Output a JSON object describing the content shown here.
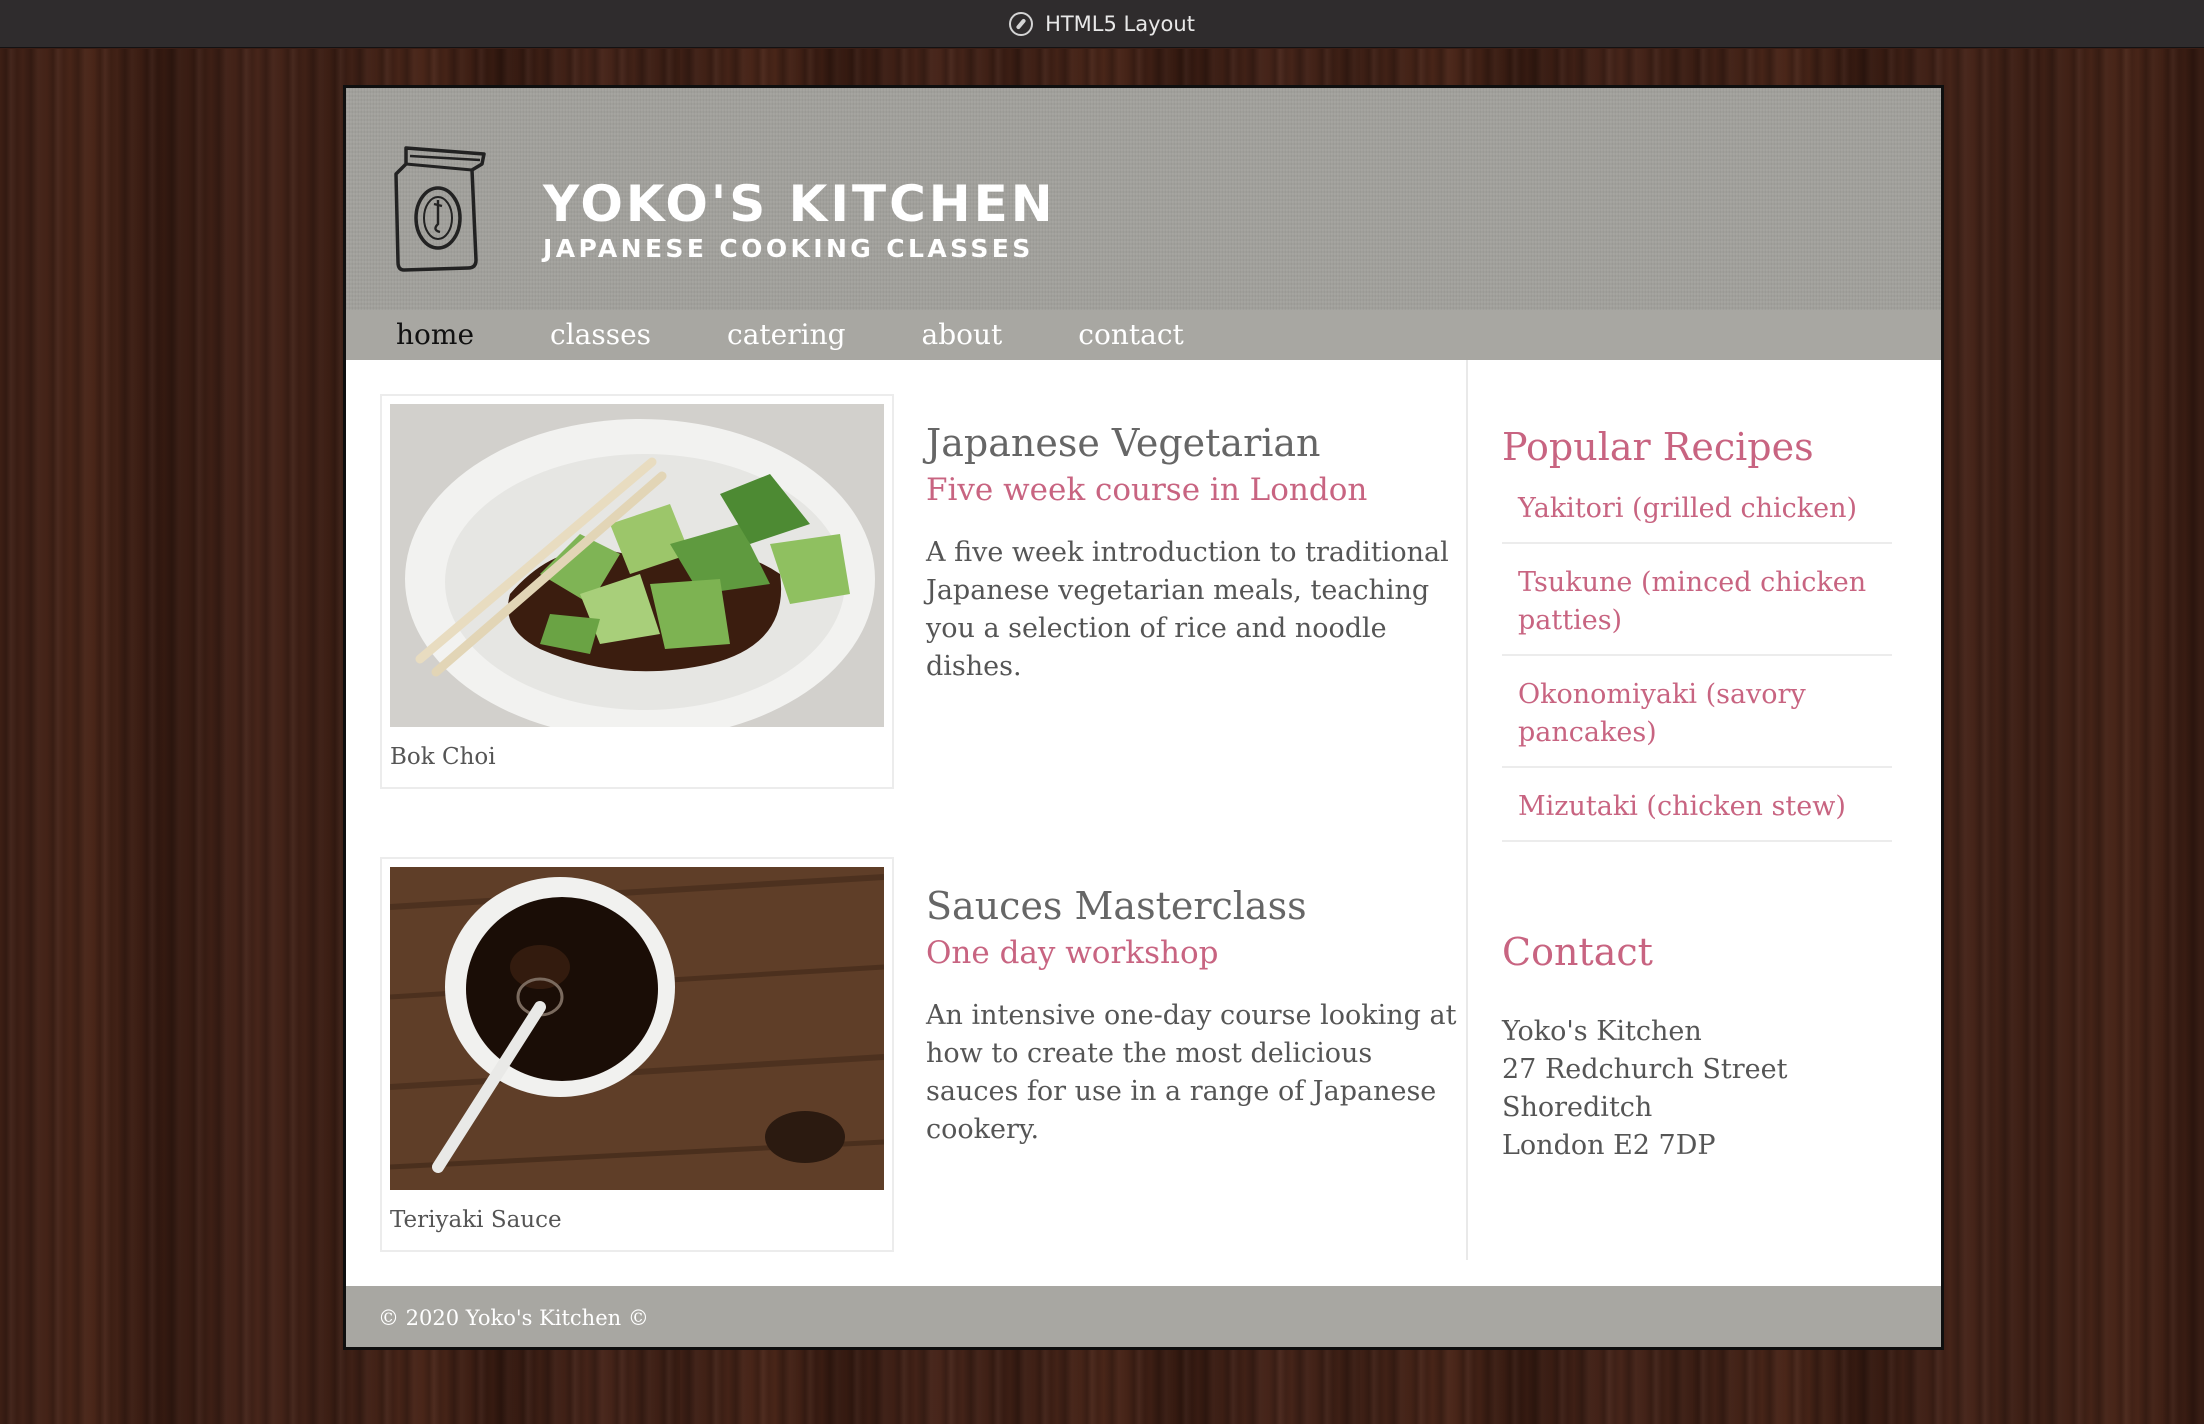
{
  "window": {
    "title": "HTML5 Layout",
    "title_icon": "compass-icon"
  },
  "header": {
    "brand_name": "YOKO'S KITCHEN",
    "brand_tagline": "JAPANESE COOKING CLASSES",
    "logo_icon": "bag-logo-icon"
  },
  "nav": {
    "items": [
      {
        "label": "home",
        "active": true
      },
      {
        "label": "classes",
        "active": false
      },
      {
        "label": "catering",
        "active": false
      },
      {
        "label": "about",
        "active": false
      },
      {
        "label": "contact",
        "active": false
      }
    ]
  },
  "courses": [
    {
      "image_caption": "Bok Choi",
      "title": "Japanese Vegetarian",
      "subtitle": "Five week course in London",
      "description": "A five week introduction to traditional Japanese vegetarian meals, teaching you a selection of rice and noodle dishes."
    },
    {
      "image_caption": "Teriyaki Sauce",
      "title": "Sauces Masterclass",
      "subtitle": "One day workshop",
      "description": "An intensive one-day course looking at how to create the most delicious sauces for use in a range of Japanese cookery."
    }
  ],
  "sidebar": {
    "popular_heading": "Popular Recipes",
    "recipes": [
      "Yakitori (grilled chicken)",
      "Tsukune (minced chicken patties)",
      "Okonomiyaki (savory pancakes)",
      "Mizutaki (chicken stew)"
    ],
    "contact_heading": "Contact",
    "address": [
      "Yoko's Kitchen",
      "27 Redchurch Street",
      "Shoreditch",
      "London E2 7DP"
    ]
  },
  "footer": {
    "text": "© 2020 Yoko's Kitchen ©"
  },
  "colors": {
    "accent": "#c86481",
    "header_bg": "#a3a29d",
    "nav_bg": "#a8a7a2",
    "text": "#555555"
  }
}
